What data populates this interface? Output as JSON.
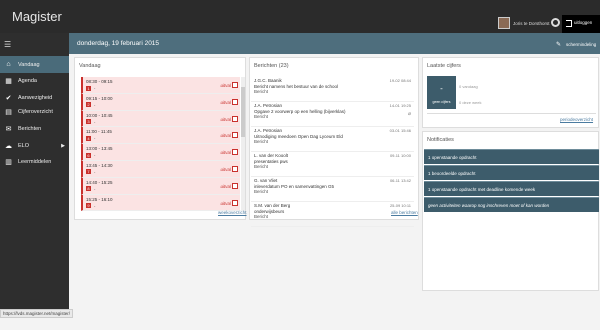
{
  "app": {
    "title": "Magister"
  },
  "user": {
    "name": "Joris te Dorsthorst",
    "logout_label": "uitloggen",
    "logout_tooltip": "uitloggen"
  },
  "sidebar": {
    "items": [
      {
        "label": "Vandaag",
        "icon": "home-icon",
        "active": true
      },
      {
        "label": "Agenda",
        "icon": "calendar-icon"
      },
      {
        "label": "Aanwezigheid",
        "icon": "check-circle-icon"
      },
      {
        "label": "Cijferoverzicht",
        "icon": "grades-icon"
      },
      {
        "label": "Berichten",
        "icon": "messages-icon"
      },
      {
        "label": "ELO",
        "icon": "cloud-icon",
        "has_submenu": true
      },
      {
        "label": "Leermiddelen",
        "icon": "books-icon"
      }
    ]
  },
  "header": {
    "date": "donderdag, 19 februari 2015",
    "layout_label": "schermindeling"
  },
  "vandaag": {
    "title": "Vandaag",
    "link": "weekoverzicht",
    "rows": [
      {
        "time": "08:30 - 09:15",
        "hour": "1",
        "status": "uitval"
      },
      {
        "time": "09:15 - 10:00",
        "hour": "2",
        "status": "uitval"
      },
      {
        "time": "10:00 - 10:45",
        "hour": "3",
        "status": "uitval"
      },
      {
        "time": "11:00 - 11:45",
        "hour": "4",
        "status": "uitval"
      },
      {
        "time": "13:00 - 13:45",
        "hour": "6",
        "status": "uitval"
      },
      {
        "time": "13:45 - 14:30",
        "hour": "7",
        "status": "uitval"
      },
      {
        "time": "14:40 - 15:25",
        "hour": "8",
        "status": "uitval"
      },
      {
        "time": "15:25 - 16:10",
        "hour": "9",
        "status": "uitval"
      }
    ]
  },
  "berichten": {
    "title": "Berichten (23)",
    "link": "alle berichten",
    "messages": [
      {
        "from": "J.G.C. Baanik",
        "subject": "Bericht namens het bestuur van de school",
        "type": "Bericht",
        "date": "19-02 08:44"
      },
      {
        "from": "J.A. Petrosian",
        "subject": "Opgave 2 voorwerp op een helling (bijverklas)",
        "type": "Bericht",
        "date": "14-01 19:25",
        "attachment": true
      },
      {
        "from": "J.A. Petrosian",
        "subject": "Uitnodiging meedoen Open Dag Lyceum Eld",
        "type": "Bericht",
        "date": "03-01 15:46"
      },
      {
        "from": "L. van der Kooolt",
        "subject": "presentaties pws",
        "type": "Bericht",
        "date": "09-11 10:00"
      },
      {
        "from": "G. van Vliet",
        "subject": "inleverdatum PO en samenvattingen G5",
        "type": "Bericht",
        "date": "06-11 13:42"
      },
      {
        "from": "S.M. van der Berg",
        "subject": "onderwijsbeurs",
        "type": "Bericht",
        "date": "25-09 10:11"
      }
    ]
  },
  "cijfers": {
    "title": "Laatste cijfers",
    "grade_value": "-",
    "grade_label": "geen cijfers",
    "meta1": "0 vandaag",
    "meta2": "0 deze week",
    "link": "periodeoverzicht"
  },
  "notificaties": {
    "title": "Notificaties",
    "items": [
      {
        "text": "1 openstaande opdracht"
      },
      {
        "text": "1 beoordeelde opdracht"
      },
      {
        "text": "1 openstaande opdracht met deadline komende week"
      },
      {
        "text": "geen activiteiten waarop nog inschreven moet of kan worden",
        "italic": true
      }
    ]
  },
  "status_url": "https://lvds.magister.net/magister/"
}
